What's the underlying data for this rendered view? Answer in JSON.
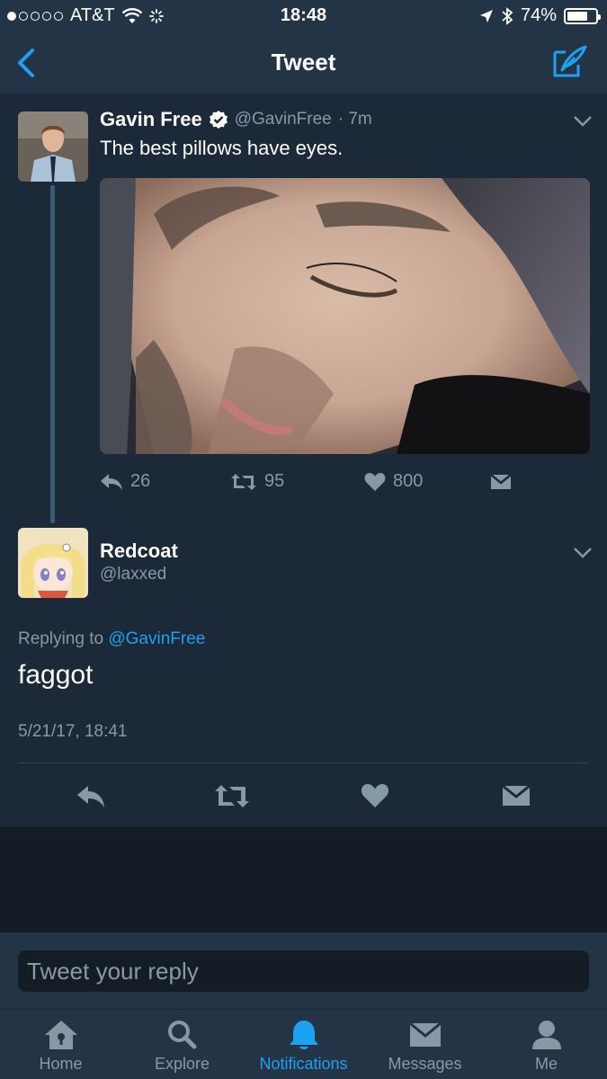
{
  "status_bar": {
    "carrier": "AT&T",
    "time": "18:48",
    "battery": "74%",
    "battery_level": 0.74
  },
  "nav": {
    "title": "Tweet",
    "back_icon": "chevron-left-icon",
    "compose_icon": "compose-icon"
  },
  "original_tweet": {
    "name": "Gavin Free",
    "verified": true,
    "handle": "@GavinFree",
    "time_ago": "· 7m",
    "text": "The best pillows have eyes.",
    "reply_count": "26",
    "retweet_count": "95",
    "like_count": "800"
  },
  "reply_tweet": {
    "name": "Redcoat",
    "handle": "@laxxed",
    "replying_prefix": "Replying to",
    "replying_to": "@GavinFree",
    "text": "faggot",
    "timestamp": "5/21/17, 18:41"
  },
  "reply_box": {
    "placeholder": "Tweet your reply"
  },
  "tabs": [
    {
      "label": "Home",
      "icon": "home-icon"
    },
    {
      "label": "Explore",
      "icon": "search-icon"
    },
    {
      "label": "Notifications",
      "icon": "bell-icon"
    },
    {
      "label": "Messages",
      "icon": "envelope-icon"
    },
    {
      "label": "Me",
      "icon": "person-icon"
    }
  ],
  "colors": {
    "background": "#1c2938",
    "bar": "#243447",
    "accent": "#1da1f2",
    "muted": "#8899a6"
  }
}
